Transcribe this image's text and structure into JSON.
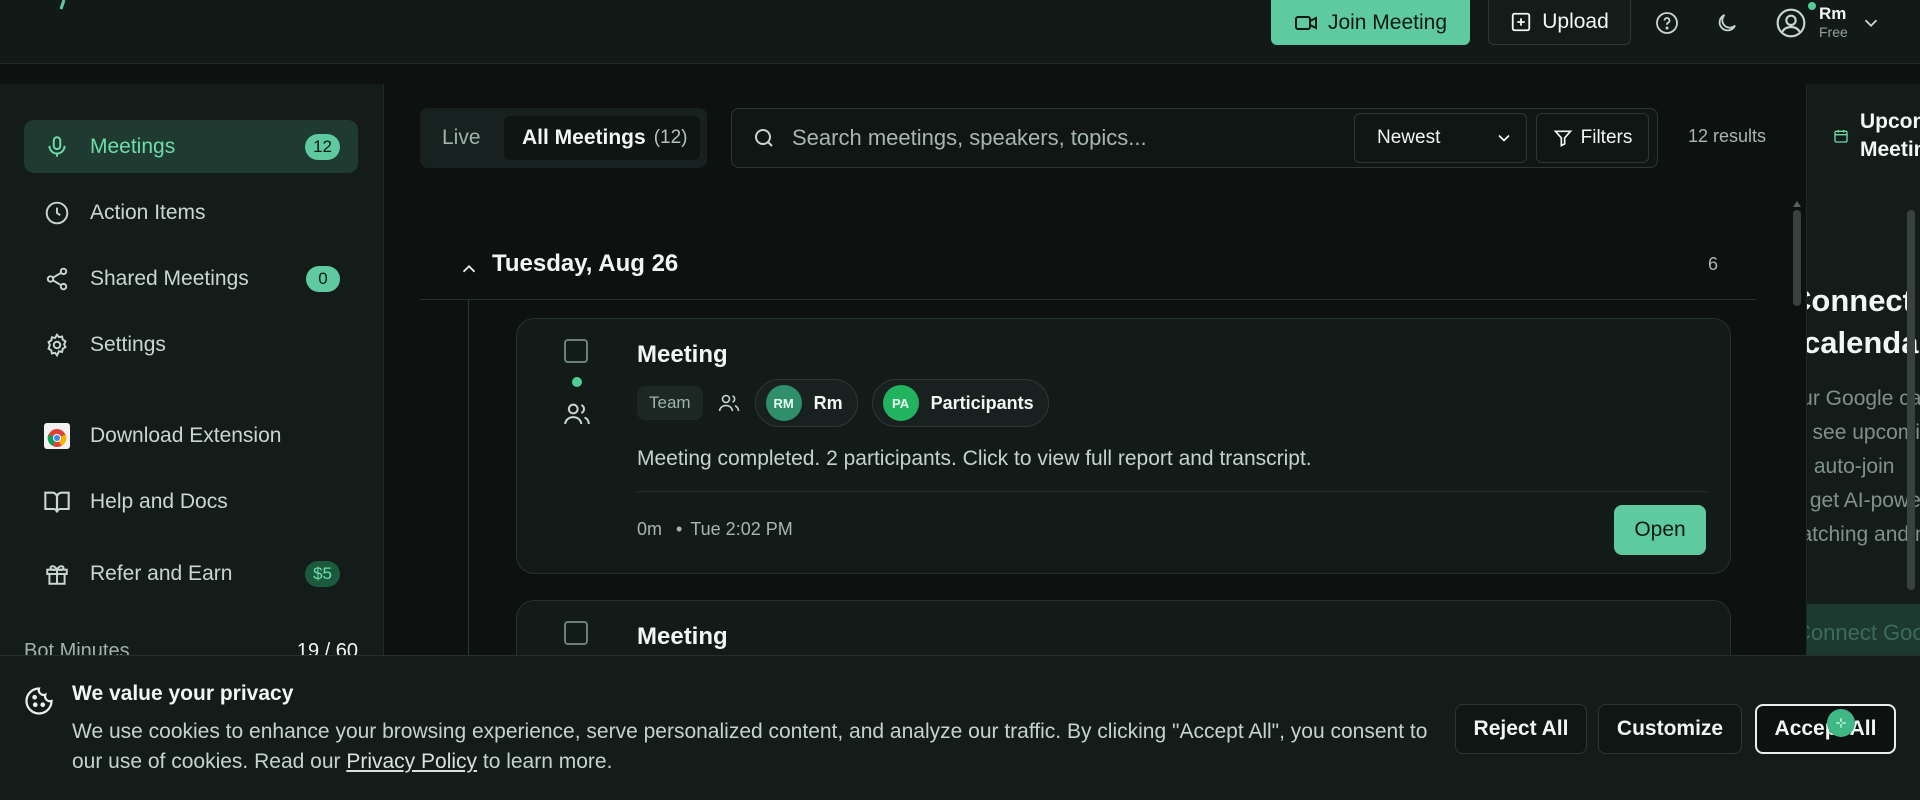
{
  "topbar": {
    "join_label": "Join Meeting",
    "upload_label": "Upload",
    "user_name": "Rm",
    "user_plan": "Free"
  },
  "sidebar": {
    "items": [
      {
        "label": "Meetings",
        "badge": "12",
        "icon": "microphone-icon"
      },
      {
        "label": "Action Items",
        "icon": "clock-icon"
      },
      {
        "label": "Shared Meetings",
        "badge": "0",
        "icon": "share-icon"
      },
      {
        "label": "Settings",
        "icon": "gear-icon"
      },
      {
        "label": "Download Extension",
        "icon": "chrome-icon"
      },
      {
        "label": "Help and Docs",
        "icon": "book-icon"
      },
      {
        "label": "Refer and Earn",
        "badge": "$5",
        "icon": "gift-icon"
      }
    ],
    "bot_minutes_label": "Bot Minutes",
    "bot_minutes_value": "19 / 60"
  },
  "tabs": {
    "live": "Live",
    "all": "All Meetings",
    "all_count": "(12)"
  },
  "search": {
    "placeholder": "Search meetings, speakers, topics...",
    "value": ""
  },
  "sort": {
    "selected": "Newest"
  },
  "filters_label": "Filters",
  "results_label": "12 results",
  "right_panel": {
    "title_line1": "Upcoming",
    "title_line2": "Meetings",
    "connect_line1": "Connect your",
    "connect_line2": "calendar",
    "text_lines": [
      "your Google calendar",
      "Outlook to see upcoming",
      "meetings, auto-join",
      "and get AI-powered",
      "matching and more"
    ],
    "button_label": "Connect Google"
  },
  "day_group": {
    "title": "Tuesday, Aug 26",
    "count": "6"
  },
  "meetings": [
    {
      "title": "Meeting",
      "tag": "Team",
      "chips": [
        {
          "initials": "RM",
          "label": "Rm",
          "color": "#2e8f6a"
        },
        {
          "initials": "PA",
          "label": "Participants",
          "color": "#22b35e"
        }
      ],
      "description": "Meeting completed. 2 participants. Click to view full report and transcript.",
      "duration": "0m",
      "time": "Tue 2:02 PM",
      "open_label": "Open"
    },
    {
      "title": "Meeting"
    }
  ],
  "cookie": {
    "title": "We value your privacy",
    "text_before": "We use cookies to enhance your browsing experience, serve personalized content, and analyze our traffic. By clicking \"Accept All\", you consent to our use of cookies. Read our ",
    "link": "Privacy Policy",
    "text_after": " to learn more.",
    "reject": "Reject All",
    "customize": "Customize",
    "accept": "Accept All"
  },
  "colors": {
    "accent": "#5fc9a0",
    "background": "#0d1211",
    "panel": "#141c1a"
  }
}
